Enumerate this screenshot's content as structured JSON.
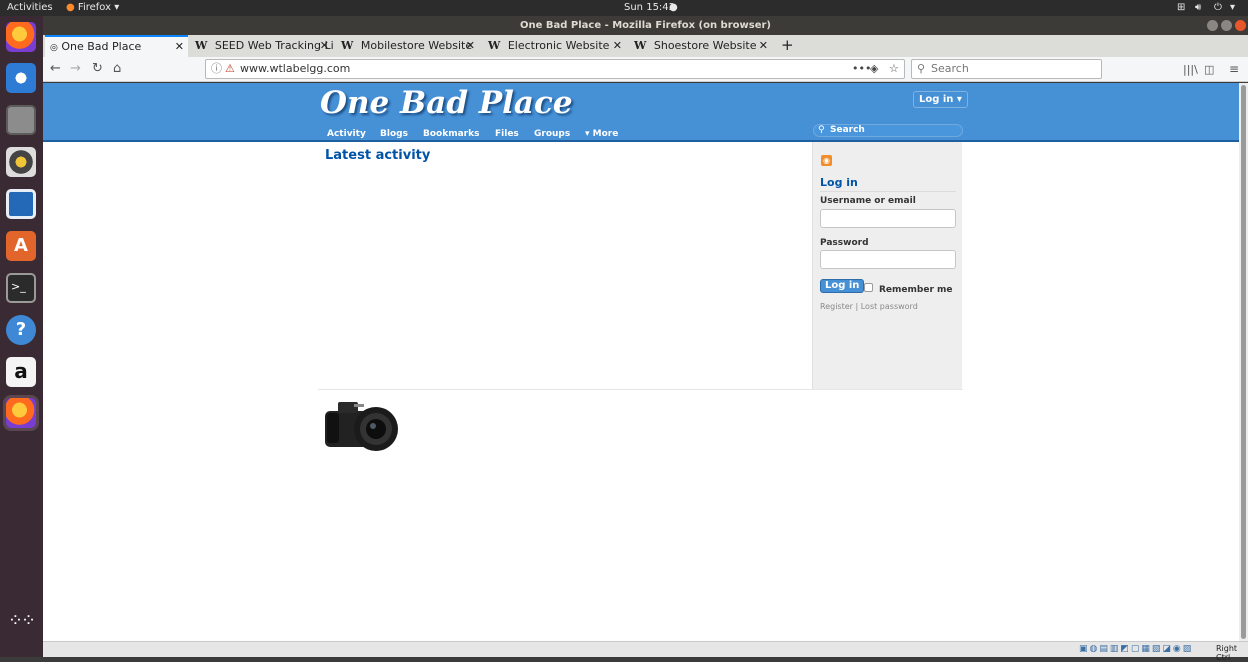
{
  "system": {
    "activities": "Activities",
    "app_menu": "Firefox",
    "clock": "Sun 15:42",
    "window_title": "One Bad Place - Mozilla Firefox (on browser)"
  },
  "tabs": [
    {
      "label": "One Bad Place",
      "active": true
    },
    {
      "label": "SEED Web Tracking Li",
      "active": false
    },
    {
      "label": "Mobilestore Website",
      "active": false
    },
    {
      "label": "Electronic Website",
      "active": false
    },
    {
      "label": "Shoestore Website",
      "active": false
    }
  ],
  "browser": {
    "url": "www.wtlabelgg.com",
    "search_placeholder": "Search",
    "new_tab": "+"
  },
  "site": {
    "title": "One Bad Place",
    "login_button": "Log in ▾",
    "menu": [
      "Activity",
      "Blogs",
      "Bookmarks",
      "Files",
      "Groups",
      "▾ More"
    ],
    "search_placeholder": "Search",
    "main_heading": "Latest activity",
    "sidebar": {
      "title": "Log in",
      "username_label": "Username or email",
      "password_label": "Password",
      "login_button": "Log in",
      "remember_label": "Remember me",
      "register_link": "Register",
      "separator": "|",
      "lost_password_link": "Lost password"
    }
  },
  "colors": {
    "header": "#4690d6",
    "link": "#0054a7"
  },
  "statusbar": {
    "host_key": "Right Ctrl"
  }
}
